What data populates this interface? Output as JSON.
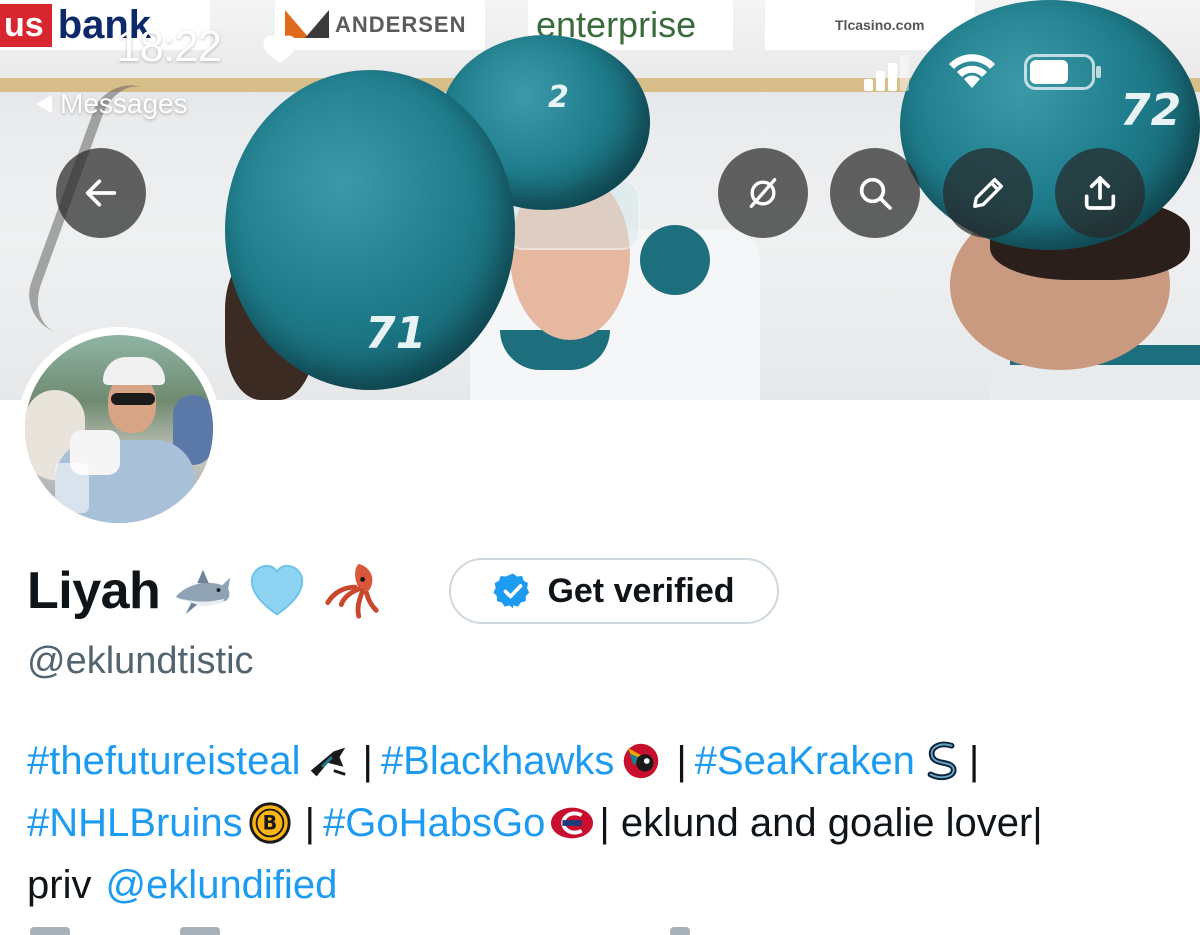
{
  "status_bar": {
    "time": "18:22",
    "back_app_label": "Messages"
  },
  "banner": {
    "ads": {
      "usbank_us": "us",
      "usbank_bank": "bank",
      "andersen": "ANDERSEN",
      "enterprise": "enterprise",
      "casino": "Tlcasino.com"
    },
    "jersey_numbers": [
      "2",
      "71",
      "72"
    ]
  },
  "header_actions": {
    "back": "back-arrow-icon",
    "hide": "eye-slash-icon",
    "search": "search-icon",
    "edit": "pencil-icon",
    "share": "share-icon"
  },
  "profile": {
    "display_name": "Liyah",
    "name_emojis": [
      "shark",
      "light-blue-heart",
      "squid"
    ],
    "verify_button_label": "Get verified",
    "handle": "@eklundtistic",
    "bio": {
      "line1": {
        "tag1": "#thefutureisteal",
        "sep1": "|",
        "tag2": "#Blackhawks",
        "sep2": "|",
        "tag3": "#SeaKraken",
        "sep3": "|"
      },
      "line2": {
        "tag4": "#NHLBruins",
        "sep4": "|",
        "tag5": "#GoHabsGo",
        "text": "| eklund and goalie lover|"
      },
      "line3": {
        "text": "priv",
        "mention": "@eklundified"
      }
    }
  },
  "colors": {
    "link": "#1d9bf0",
    "secondary_text": "#536471",
    "primary_text": "#0f1419",
    "button_bg": "#282828",
    "verified_badge": "#1d9bf0",
    "helmet_teal": "#1f7e8d"
  }
}
